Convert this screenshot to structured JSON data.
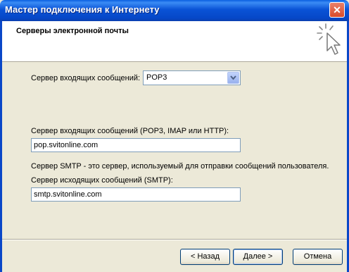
{
  "window": {
    "title": "Мастер подключения к Интернету"
  },
  "header": {
    "title": "Серверы электронной почты",
    "icon": "sparkle-cursor-icon"
  },
  "incoming_type": {
    "label": "Сервер входящих сообщений:",
    "value": "POP3"
  },
  "incoming_server": {
    "label": "Сервер входящих сообщений (POP3, IMAP или HTTP):",
    "value": "pop.svitonline.com"
  },
  "smtp_note": "Сервер SMTP - это сервер, используемый для отправки сообщений  пользователя.",
  "outgoing_server": {
    "label": "Сервер исходящих сообщений (SMTP):",
    "value": "smtp.svitonline.com"
  },
  "buttons": {
    "back": "< Назад",
    "next": "Далее >",
    "cancel": "Отмена"
  },
  "colors": {
    "titlebar": "#0a53d6",
    "face": "#ece9d8",
    "close": "#d94a2a"
  }
}
